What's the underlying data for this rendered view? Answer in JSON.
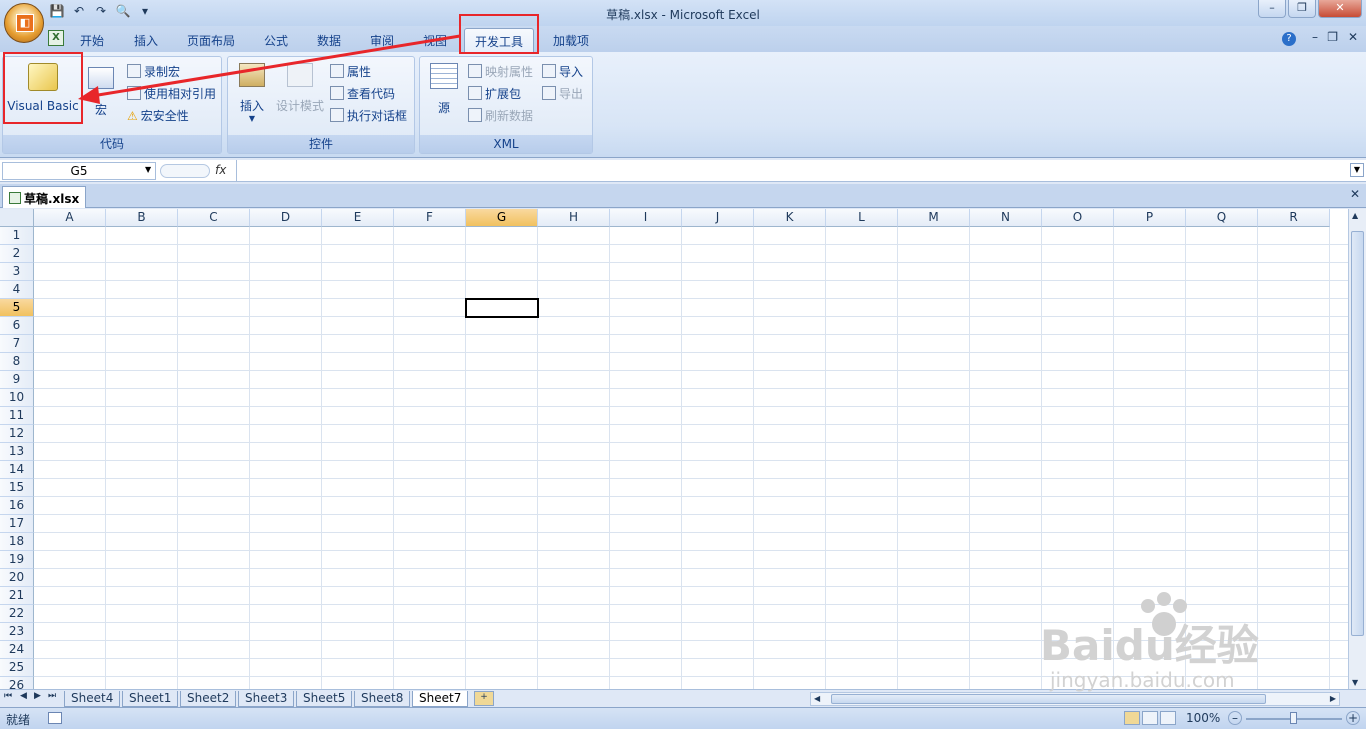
{
  "window": {
    "title": "草稿.xlsx - Microsoft Excel"
  },
  "qat": {
    "save": "💾",
    "undo": "↶",
    "redo": "↷",
    "preview": "🔍",
    "more": "▾"
  },
  "ribbon_tabs": [
    "开始",
    "插入",
    "页面布局",
    "公式",
    "数据",
    "审阅",
    "视图",
    "开发工具",
    "加载项"
  ],
  "active_tab": "开发工具",
  "groups": {
    "code": {
      "label": "代码",
      "visual_basic": "Visual Basic",
      "macro": "宏",
      "record_macro": "录制宏",
      "relative_ref": "使用相对引用",
      "macro_security": "宏安全性"
    },
    "controls": {
      "label": "控件",
      "insert": "插入",
      "design_mode": "设计模式",
      "properties": "属性",
      "view_code": "查看代码",
      "run_dialog": "执行对话框"
    },
    "xml": {
      "label": "XML",
      "source": "源",
      "map_properties": "映射属性",
      "expansion_packs": "扩展包",
      "refresh_data": "刷新数据",
      "import": "导入",
      "export": "导出"
    }
  },
  "formula_bar": {
    "name_box": "G5",
    "fx": "fx",
    "value": ""
  },
  "workbook_tab": "草稿.xlsx",
  "columns": [
    "A",
    "B",
    "C",
    "D",
    "E",
    "F",
    "G",
    "H",
    "I",
    "J",
    "K",
    "L",
    "M",
    "N",
    "O",
    "P",
    "Q",
    "R"
  ],
  "rows": [
    "1",
    "2",
    "3",
    "4",
    "5",
    "6",
    "7",
    "8",
    "9",
    "10",
    "11",
    "12",
    "13",
    "14",
    "15",
    "16",
    "17",
    "18",
    "19",
    "20",
    "21",
    "22",
    "23",
    "24",
    "25",
    "26"
  ],
  "selected": {
    "column": "G",
    "row": "5"
  },
  "sheets": [
    "Sheet4",
    "Sheet1",
    "Sheet2",
    "Sheet3",
    "Sheet5",
    "Sheet8",
    "Sheet7"
  ],
  "active_sheet": "Sheet7",
  "status": {
    "mode": "就绪",
    "zoom": "100%"
  },
  "watermark": {
    "text": "Baidu经验",
    "sub": "jingyan.baidu.com"
  }
}
